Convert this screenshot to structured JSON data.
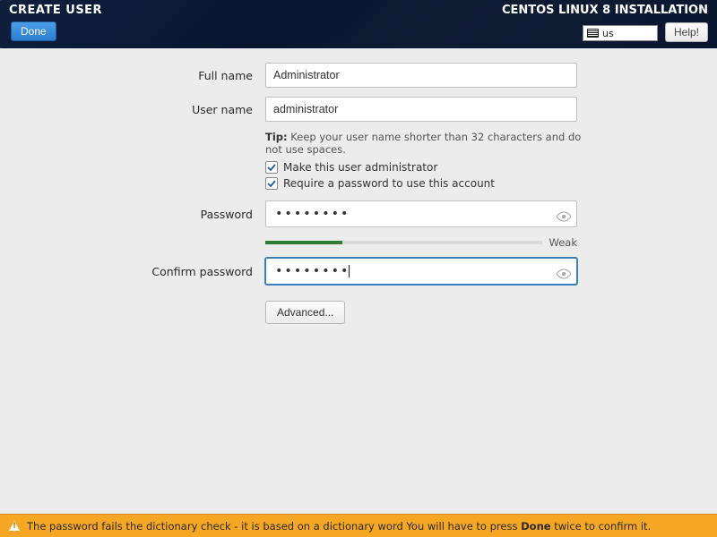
{
  "header": {
    "title": "CREATE USER",
    "installer_title": "CENTOS LINUX 8 INSTALLATION",
    "done_label": "Done",
    "keyboard_layout": "us",
    "help_label": "Help!"
  },
  "form": {
    "full_name_label": "Full name",
    "full_name_value": "Administrator",
    "user_name_label": "User name",
    "user_name_value": "administrator",
    "tip_prefix": "Tip:",
    "tip_text": " Keep your user name shorter than 32 characters and do not use spaces.",
    "check_admin_label": "Make this user administrator",
    "check_admin_checked": true,
    "check_require_pw_label": "Require a password to use this account",
    "check_require_pw_checked": true,
    "password_label": "Password",
    "password_value": "••••••••",
    "strength_label": "Weak",
    "strength_percent": 28,
    "confirm_label": "Confirm password",
    "confirm_value": "••••••••",
    "advanced_label": "Advanced..."
  },
  "warning": {
    "text_before": "The password fails the dictionary check - it is based on a dictionary word You will have to press ",
    "bold": "Done",
    "text_after": " twice to confirm it."
  },
  "colors": {
    "header_bg": "#0a1630",
    "accent_blue": "#3a7fbf",
    "warn_bg": "#f5a623",
    "strength_green": "#2e7d32"
  }
}
